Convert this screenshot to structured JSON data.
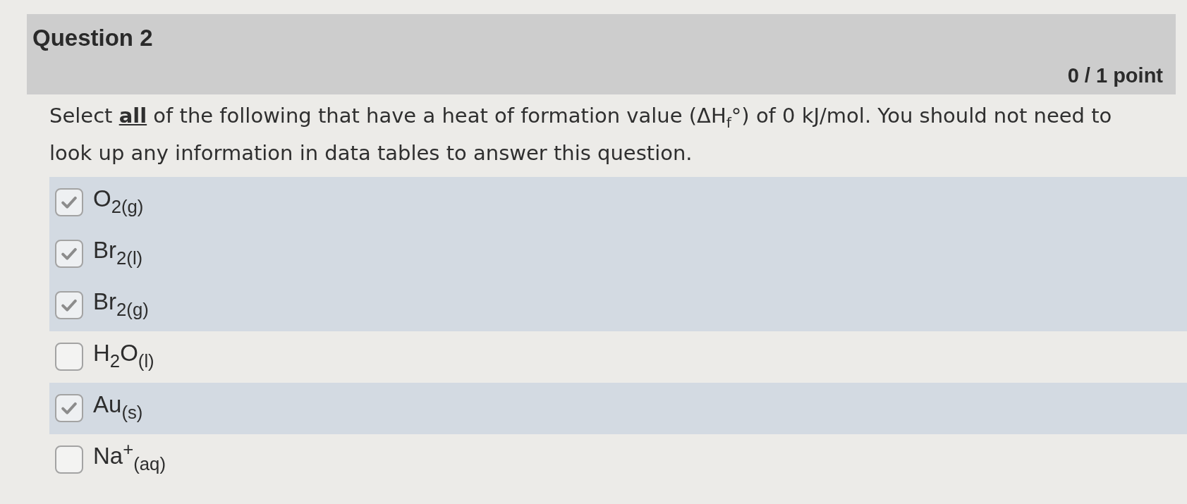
{
  "question": {
    "title": "Question 2",
    "points": "0 / 1 point",
    "prompt": "Select **all** of the following that have a heat of formation value (ΔH$_{f}$°) of 0 kJ/mol. You should not need to look up any information in data tables to answer this question."
  },
  "options": [
    {
      "label": "O$_{2(g)}$",
      "checked": true
    },
    {
      "label": "Br$_{2(l)}$",
      "checked": true
    },
    {
      "label": "Br$_{2(g)}$",
      "checked": true
    },
    {
      "label": "H$_{2}$O$_{(l)}$",
      "checked": false
    },
    {
      "label": "Au$_{(s)}$",
      "checked": true
    },
    {
      "label": "Na$^{+}$$_{(aq)}$",
      "checked": false
    }
  ]
}
